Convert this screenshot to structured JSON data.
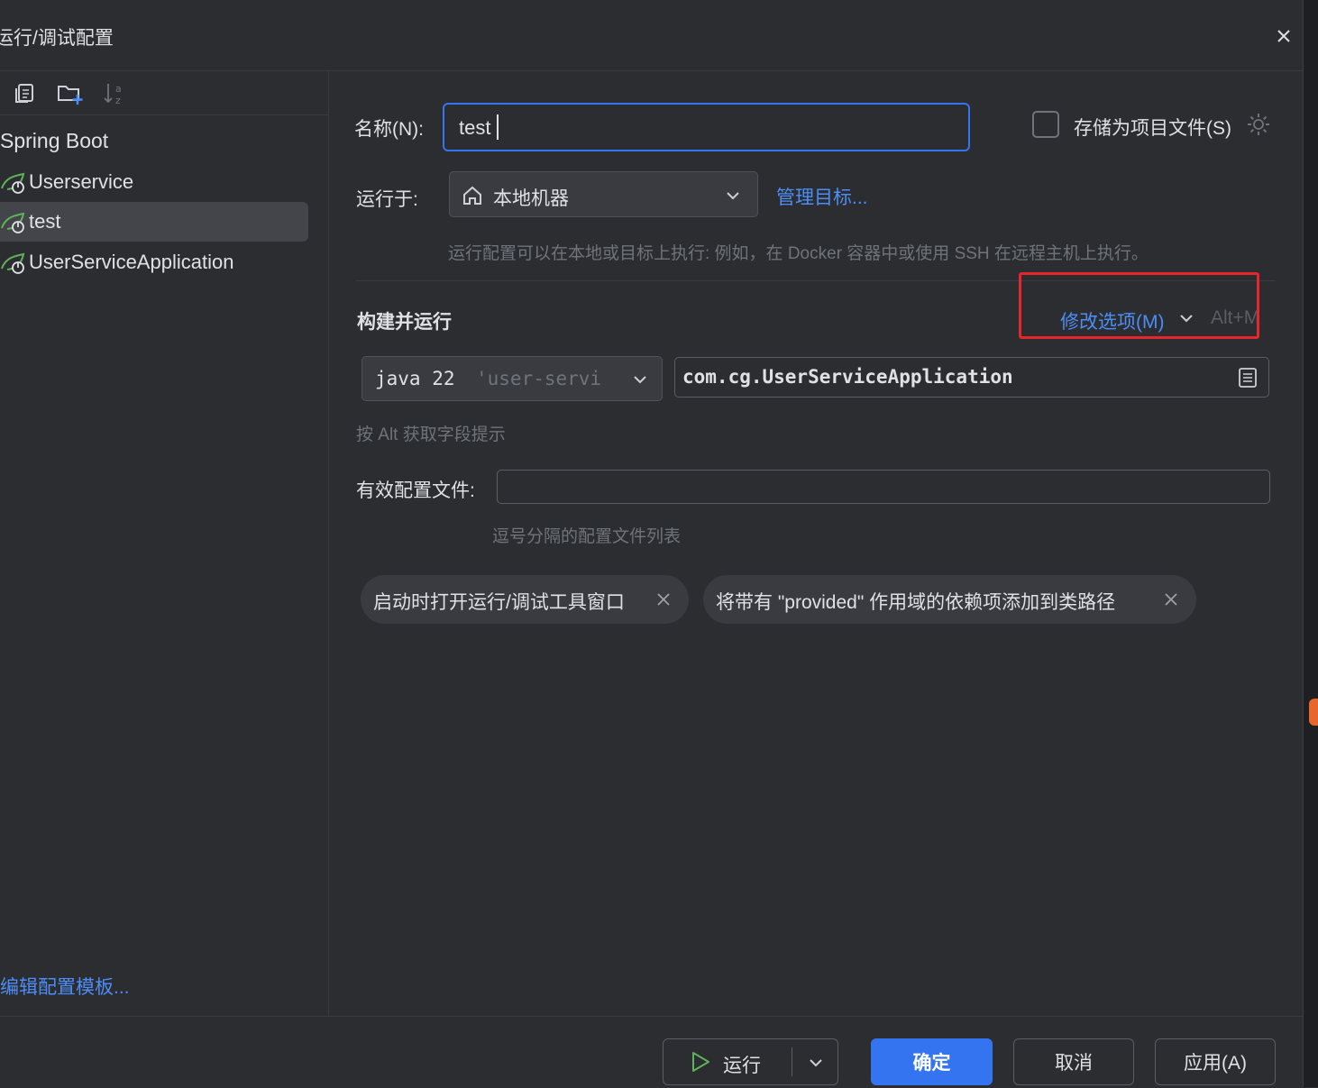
{
  "dialog": {
    "title": "运行/调试配置"
  },
  "sidebar": {
    "group_title": "Spring Boot",
    "items": [
      {
        "label": "Userservice",
        "selected": false
      },
      {
        "label": "test",
        "selected": true
      },
      {
        "label": "UserServiceApplication",
        "selected": false
      }
    ],
    "templates_link": "编辑配置模板..."
  },
  "form": {
    "name_label": "名称(N):",
    "name_value": "test",
    "store_as_project_file": "存储为项目文件(S)",
    "store_checked": false,
    "run_on_label": "运行于:",
    "run_on_value": "本地机器",
    "manage_targets": "管理目标...",
    "run_on_hint": "运行配置可以在本地或目标上执行: 例如，在 Docker 容器中或使用 SSH 在远程主机上执行。",
    "section_title": "构建并运行",
    "modify_options": "修改选项(M)",
    "modify_shortcut": "Alt+M",
    "jdk_prefix": "java 22",
    "jdk_module": "'user-servi",
    "main_class": "com.cg.UserServiceApplication",
    "alt_hint": "按 Alt 获取字段提示",
    "profiles_label": "有效配置文件:",
    "profiles_value": "",
    "profiles_hint": "逗号分隔的配置文件列表",
    "chips": [
      "启动时打开运行/调试工具窗口",
      "将带有 \"provided\" 作用域的依赖项添加到类路径"
    ]
  },
  "buttons": {
    "run": "运行",
    "ok": "确定",
    "cancel": "取消",
    "apply": "应用(A)"
  },
  "colors": {
    "background": "#2b2d30",
    "accent": "#3574f0",
    "link": "#4d8df6",
    "highlight_box": "#e5262b",
    "spring_icon": "#5fb25b"
  },
  "icons": {
    "close": "close-icon",
    "copy": "copy-config-icon",
    "folder": "new-folder-icon",
    "sort": "sort-alpha-icon",
    "spring": "spring-boot-icon",
    "home": "home-icon",
    "gear": "gear-icon",
    "browse": "browse-file-icon",
    "play": "play-icon",
    "chevron": "chevron-down-icon"
  }
}
